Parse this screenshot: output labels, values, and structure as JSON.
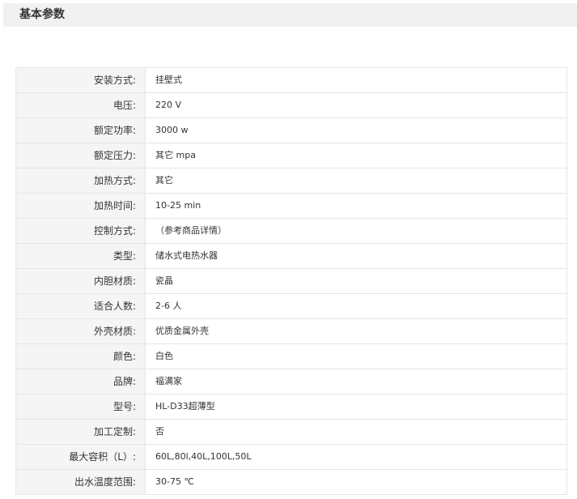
{
  "section": {
    "title": "基本参数"
  },
  "params": [
    {
      "label": "安装方式:",
      "value": "挂壁式"
    },
    {
      "label": "电压:",
      "value": "220 V"
    },
    {
      "label": "额定功率:",
      "value": "3000 w"
    },
    {
      "label": "额定压力:",
      "value": "其它 mpa"
    },
    {
      "label": "加热方式:",
      "value": "其它"
    },
    {
      "label": "加热时间:",
      "value": "10-25 min"
    },
    {
      "label": "控制方式:",
      "value": "（参考商品详情）"
    },
    {
      "label": "类型:",
      "value": "储水式电热水器"
    },
    {
      "label": "内胆材质:",
      "value": "瓷晶"
    },
    {
      "label": "适合人数:",
      "value": "2-6 人"
    },
    {
      "label": "外壳材质:",
      "value": "优质金属外壳"
    },
    {
      "label": "颜色:",
      "value": "白色"
    },
    {
      "label": "品牌:",
      "value": "福满家"
    },
    {
      "label": "型号:",
      "value": "HL-D33超薄型"
    },
    {
      "label": "加工定制:",
      "value": "否"
    },
    {
      "label": "最大容积（L）:",
      "value": "60L,80l,40L,100L,50L"
    },
    {
      "label": "出水温度范围:",
      "value": "30-75 ℃"
    }
  ],
  "colors": {
    "header_background": "#f1f1f1",
    "label_background": "#f5f5f5",
    "border": "#e5e5e5",
    "text": "#333333"
  }
}
